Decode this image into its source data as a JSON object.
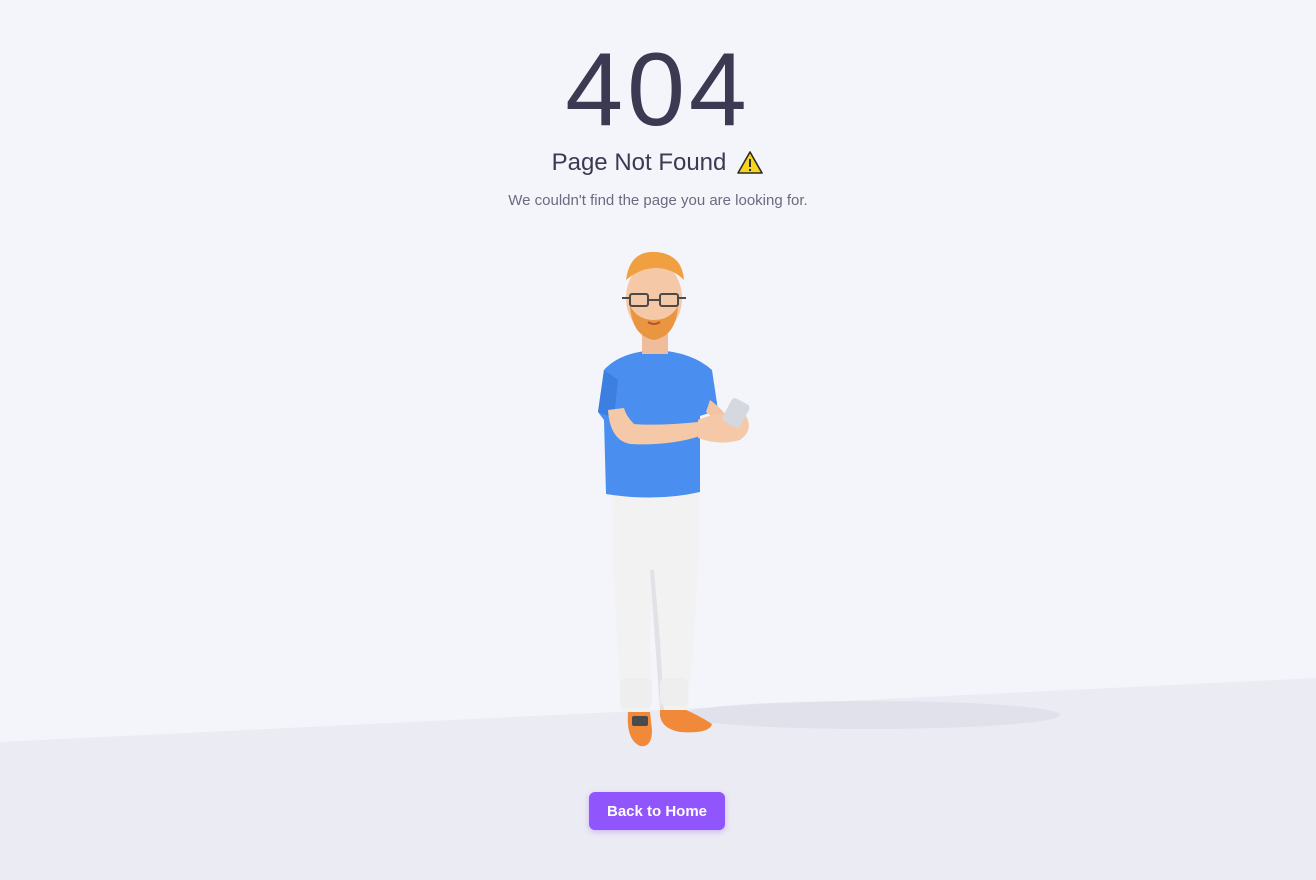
{
  "error": {
    "code": "404",
    "title": "Page Not Found",
    "message": "We couldn't find the page you are looking for."
  },
  "actions": {
    "back_home_label": "Back to Home"
  },
  "icons": {
    "title_icon": "warning-icon",
    "illustration": "person-holding-phone-illustration"
  },
  "colors": {
    "background": "#f4f5fa",
    "floor": "#ebebf3",
    "heading": "#3b3a52",
    "text_muted": "#6b6a80",
    "primary": "#9155fd"
  }
}
